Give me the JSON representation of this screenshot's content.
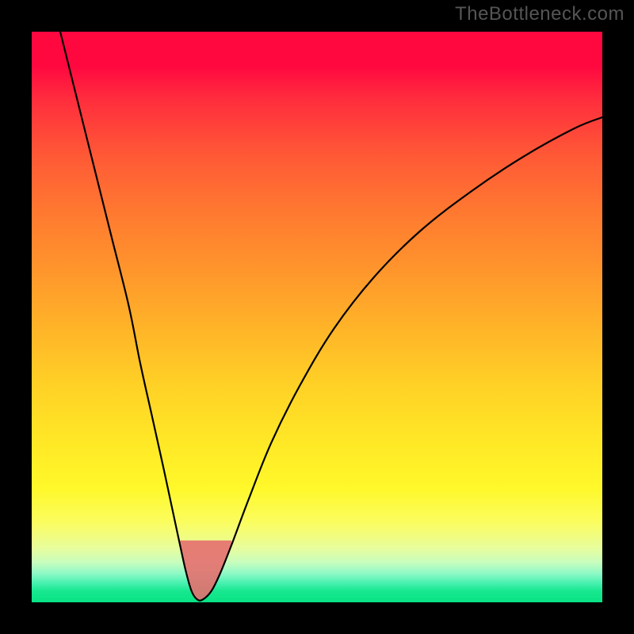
{
  "watermark": "TheBottleneck.com",
  "chart_data": {
    "type": "line",
    "title": "",
    "xlabel": "",
    "ylabel": "",
    "x_range": [
      0,
      100
    ],
    "y_range": [
      0,
      100
    ],
    "series": [
      {
        "name": "bottleneck-curve",
        "x": [
          5,
          8,
          11,
          14,
          17,
          19,
          21,
          23,
          24.5,
          26,
          27,
          28,
          29,
          30,
          31.5,
          33,
          35,
          38,
          42,
          47,
          53,
          60,
          68,
          77,
          86,
          95,
          100
        ],
        "y": [
          100,
          88,
          76,
          64,
          52,
          42,
          33,
          24,
          17,
          10,
          5.5,
          2,
          0.5,
          0.5,
          2,
          5,
          10,
          18,
          28,
          38,
          48,
          57,
          65,
          72,
          78,
          83,
          85
        ]
      }
    ],
    "gradient_stops": [
      {
        "pct": 0,
        "hex": "#ff0840"
      },
      {
        "pct": 22,
        "hex": "#ff5a36"
      },
      {
        "pct": 52,
        "hex": "#ffb428"
      },
      {
        "pct": 80,
        "hex": "#fff82a"
      },
      {
        "pct": 93,
        "hex": "#c8fdbe"
      },
      {
        "pct": 100,
        "hex": "#08e384"
      }
    ],
    "valley_fill_hex": "#e56f6f",
    "valley_x_range": [
      23.5,
      35
    ],
    "valley_y_max": 12
  }
}
